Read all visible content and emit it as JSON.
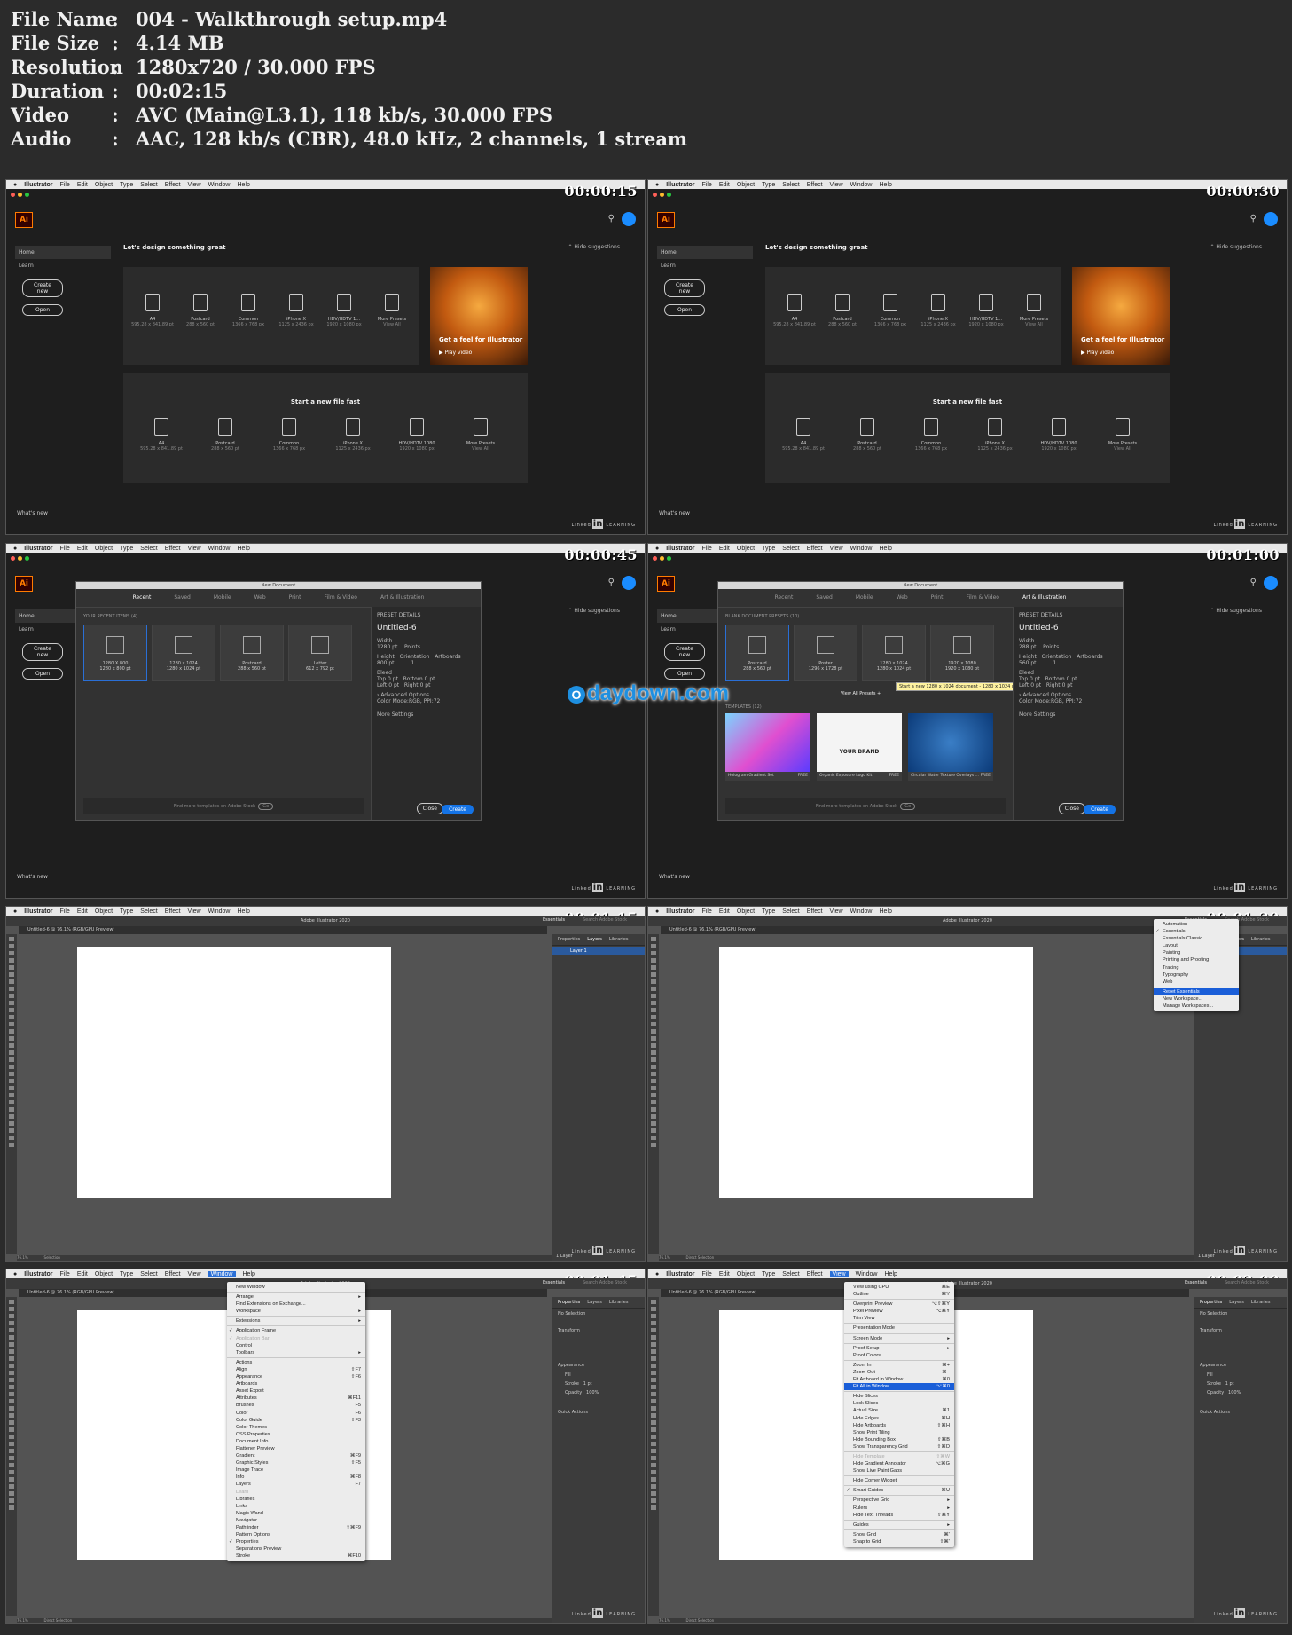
{
  "info": [
    {
      "key": "File Name",
      "value": "004 - Walkthrough setup.mp4"
    },
    {
      "key": "File Size",
      "value": "4.14 MB"
    },
    {
      "key": "Resolution",
      "value": "1280x720 / 30.000 FPS"
    },
    {
      "key": "Duration",
      "value": "00:02:15"
    },
    {
      "key": "Video",
      "value": "AVC (Main@L3.1), 118 kb/s, 30.000 FPS"
    },
    {
      "key": "Audio",
      "value": "AAC, 128 kb/s (CBR), 48.0 kHz, 2 channels, 1 stream"
    }
  ],
  "separator": ":",
  "menubar": {
    "apple": "",
    "items": [
      "Illustrator",
      "File",
      "Edit",
      "Object",
      "Type",
      "Select",
      "Effect",
      "View",
      "Window",
      "Help"
    ]
  },
  "timestamps": [
    "00:00:15",
    "00:00:30",
    "00:00:45",
    "00:01:00",
    "00:01:15",
    "00:01:30",
    "00:01:45",
    "00:02:00"
  ],
  "home": {
    "logo": "Ai",
    "nav_home": "Home",
    "nav_learn": "Learn",
    "create_new": "Create new",
    "open": "Open",
    "whats_new": "What's new",
    "greeting": "Let's design something great",
    "hide_suggestions": "Hide suggestions",
    "presets": [
      {
        "name": "A4",
        "size": "595.28 x 841.89 pt"
      },
      {
        "name": "Postcard",
        "size": "288 x 560 pt"
      },
      {
        "name": "Common",
        "size": "1366 x 768 px"
      },
      {
        "name": "iPhone X",
        "size": "1125 x 2436 px"
      },
      {
        "name": "HDV/HDTV 1...",
        "size": "1920 x 1080 px"
      },
      {
        "name": "More Presets",
        "size": "View All"
      }
    ],
    "presets_bottom": [
      {
        "name": "A4",
        "size": "595.28 x 841.89 pt"
      },
      {
        "name": "Postcard",
        "size": "288 x 560 pt"
      },
      {
        "name": "Common",
        "size": "1366 x 768 px"
      },
      {
        "name": "iPhone X",
        "size": "1125 x 2436 px"
      },
      {
        "name": "HDV/HDTV 1080",
        "size": "1920 x 1080 px"
      },
      {
        "name": "More Presets",
        "size": "View All"
      }
    ],
    "hero_title": "Get a feel for Illustrator",
    "hero_play": "Play video",
    "start_fast": "Start a new file fast"
  },
  "linkedin": {
    "a": "Linked",
    "b": "in",
    "c": "LEARNING"
  },
  "new_doc": {
    "title": "New Document",
    "tabs": [
      "Recent",
      "Saved",
      "Mobile",
      "Web",
      "Print",
      "Film & Video",
      "Art & Illustration"
    ],
    "recent_label": "YOUR RECENT ITEMS  (4)",
    "recent": [
      {
        "name": "1280 X 800",
        "size": "1280 x 800 pt"
      },
      {
        "name": "1280 x 1024",
        "size": "1280 x 1024 pt"
      },
      {
        "name": "Postcard",
        "size": "288 x 560 pt"
      },
      {
        "name": "Letter",
        "size": "612 x 792 pt"
      }
    ],
    "preset_details": "PRESET DETAILS",
    "doc_name": "Untitled-6",
    "width_label": "Width",
    "width_val_a": "1280 pt",
    "width_val_b": "288 pt",
    "units": "Points",
    "height_label": "Height",
    "height_val_a": "800 pt",
    "height_val_b": "560 pt",
    "orientation": "Orientation",
    "artboards": "Artboards",
    "artboards_val": "1",
    "bleed": "Bleed",
    "top": "Top",
    "bottom": "Bottom",
    "left": "Left",
    "right": "Right",
    "zero": "0 pt",
    "advanced": "Advanced Options",
    "color_mode": "Color Mode:RGB, PPI:72",
    "more_settings": "More Settings",
    "close": "Close",
    "create": "Create",
    "find_templates": "Find more templates on Adobe Stock",
    "go": "Go",
    "blank_label": "BLANK DOCUMENT PRESETS  (10)",
    "blank": [
      {
        "name": "Postcard",
        "size": "288 x 560 pt"
      },
      {
        "name": "Poster",
        "size": "1296 x 1728 pt"
      },
      {
        "name": "1280 x 1024",
        "size": "1280 x 1024 pt"
      },
      {
        "name": "1920 x 1080",
        "size": "1920 x 1080 pt"
      }
    ],
    "view_all_presets": "View All Presets  +",
    "tooltip": "Start a new 1280 x 1024 document - 1280 x 1024 pt",
    "templates_label": "TEMPLATES  (12)",
    "templates": [
      {
        "name": "Hologram Gradient Set",
        "badge": "FREE"
      },
      {
        "name": "Organic Exposure Logo Kit",
        "badge": "FREE"
      },
      {
        "name": "Circular Water Texture Overlays ...",
        "badge": "FREE"
      }
    ],
    "brand_text": "YOUR BRAND"
  },
  "watermark": "daydown.com",
  "watermark_o": "O",
  "workspace": {
    "title": "Adobe Illustrator 2020",
    "doc_tab": "Untitled-6 @ 76.1% (RGB/GPU Preview)",
    "essentials": "Essentials",
    "search": "Search Adobe Stock",
    "panel_tabs": [
      "Properties",
      "Layers",
      "Libraries"
    ],
    "layer_name": "Layer 1",
    "no_selection": "No Selection",
    "transform": "Transform",
    "appearance": "Appearance",
    "fill": "Fill",
    "stroke": "Stroke",
    "stroke_val": "1 pt",
    "opacity": "Opacity",
    "opacity_val": "100%",
    "quick_actions": "Quick Actions",
    "zoom": "76.1%",
    "status_sel": "Selection",
    "status_direct": "Direct Selection",
    "one_layer": "1 Layer"
  },
  "workspace_menu": [
    {
      "t": "Automation"
    },
    {
      "t": "Essentials",
      "chk": true
    },
    {
      "t": "Essentials Classic"
    },
    {
      "t": "Layout"
    },
    {
      "t": "Painting"
    },
    {
      "t": "Printing and Proofing"
    },
    {
      "t": "Tracing"
    },
    {
      "t": "Typography"
    },
    {
      "t": "Web"
    },
    {
      "sep": true
    },
    {
      "t": "Reset Essentials",
      "sel": true
    },
    {
      "t": "New Workspace..."
    },
    {
      "t": "Manage Workspaces..."
    }
  ],
  "window_menu": [
    {
      "t": "New Window"
    },
    {
      "sep": true
    },
    {
      "t": "Arrange",
      "k": "▸"
    },
    {
      "t": "Find Extensions on Exchange..."
    },
    {
      "t": "Workspace",
      "k": "▸"
    },
    {
      "sep": true
    },
    {
      "t": "Extensions",
      "k": "▸"
    },
    {
      "sep": true
    },
    {
      "t": "Application Frame",
      "chk": true
    },
    {
      "t": "Application Bar",
      "chk": true,
      "dis": true
    },
    {
      "t": "Control"
    },
    {
      "t": "Toolbars",
      "k": "▸"
    },
    {
      "sep": true
    },
    {
      "t": "Actions"
    },
    {
      "t": "Align",
      "k": "⇧F7"
    },
    {
      "t": "Appearance",
      "k": "⇧F6"
    },
    {
      "t": "Artboards"
    },
    {
      "t": "Asset Export"
    },
    {
      "t": "Attributes",
      "k": "⌘F11"
    },
    {
      "t": "Brushes",
      "k": "F5"
    },
    {
      "t": "Color",
      "k": "F6"
    },
    {
      "t": "Color Guide",
      "k": "⇧F3"
    },
    {
      "t": "Color Themes"
    },
    {
      "t": "CSS Properties"
    },
    {
      "t": "Document Info"
    },
    {
      "t": "Flattener Preview"
    },
    {
      "t": "Gradient",
      "k": "⌘F9"
    },
    {
      "t": "Graphic Styles",
      "k": "⇧F5"
    },
    {
      "t": "Image Trace"
    },
    {
      "t": "Info",
      "k": "⌘F8"
    },
    {
      "t": "Layers",
      "k": "F7"
    },
    {
      "t": "Learn",
      "dis": true
    },
    {
      "t": "Libraries"
    },
    {
      "t": "Links"
    },
    {
      "t": "Magic Wand"
    },
    {
      "t": "Navigator"
    },
    {
      "t": "Pathfinder",
      "k": "⇧⌘F9"
    },
    {
      "t": "Pattern Options"
    },
    {
      "t": "Properties",
      "chk": true
    },
    {
      "t": "Separations Preview"
    },
    {
      "t": "Stroke",
      "k": "⌘F10"
    }
  ],
  "view_menu": [
    {
      "t": "View using CPU",
      "k": "⌘E"
    },
    {
      "t": "Outline",
      "k": "⌘Y"
    },
    {
      "sep": true
    },
    {
      "t": "Overprint Preview",
      "k": "⌥⇧⌘Y"
    },
    {
      "t": "Pixel Preview",
      "k": "⌥⌘Y"
    },
    {
      "t": "Trim View"
    },
    {
      "sep": true
    },
    {
      "t": "Presentation Mode"
    },
    {
      "sep": true
    },
    {
      "t": "Screen Mode",
      "k": "▸"
    },
    {
      "sep": true
    },
    {
      "t": "Proof Setup",
      "k": "▸"
    },
    {
      "t": "Proof Colors"
    },
    {
      "sep": true
    },
    {
      "t": "Zoom In",
      "k": "⌘+"
    },
    {
      "t": "Zoom Out",
      "k": "⌘−"
    },
    {
      "t": "Fit Artboard in Window",
      "k": "⌘0"
    },
    {
      "t": "Fit All in Window",
      "k": "⌥⌘0",
      "sel": true
    },
    {
      "sep": true
    },
    {
      "t": "Hide Slices"
    },
    {
      "t": "Lock Slices"
    },
    {
      "t": "Actual Size",
      "k": "⌘1"
    },
    {
      "t": "Hide Edges",
      "k": "⌘H"
    },
    {
      "t": "Hide Artboards",
      "k": "⇧⌘H"
    },
    {
      "t": "Show Print Tiling"
    },
    {
      "t": "Hide Bounding Box",
      "k": "⇧⌘B"
    },
    {
      "t": "Show Transparency Grid",
      "k": "⇧⌘D"
    },
    {
      "sep": true
    },
    {
      "t": "Hide Template",
      "k": "⇧⌘W",
      "dis": true
    },
    {
      "t": "Hide Gradient Annotator",
      "k": "⌥⌘G"
    },
    {
      "t": "Show Live Paint Gaps"
    },
    {
      "sep": true
    },
    {
      "t": "Hide Corner Widget"
    },
    {
      "sep": true
    },
    {
      "t": "Smart Guides",
      "k": "⌘U",
      "chk": true
    },
    {
      "sep": true
    },
    {
      "t": "Perspective Grid",
      "k": "▸"
    },
    {
      "t": "Rulers",
      "k": "▸"
    },
    {
      "t": "Hide Text Threads",
      "k": "⇧⌘Y"
    },
    {
      "sep": true
    },
    {
      "t": "Guides",
      "k": "▸"
    },
    {
      "sep": true
    },
    {
      "t": "Show Grid",
      "k": "⌘'"
    },
    {
      "t": "Snap to Grid",
      "k": "⇧⌘'"
    }
  ],
  "colors": {
    "accent": "#1473e6",
    "brand": "#ff7c00",
    "menu_highlight": "#1a5ed8"
  }
}
